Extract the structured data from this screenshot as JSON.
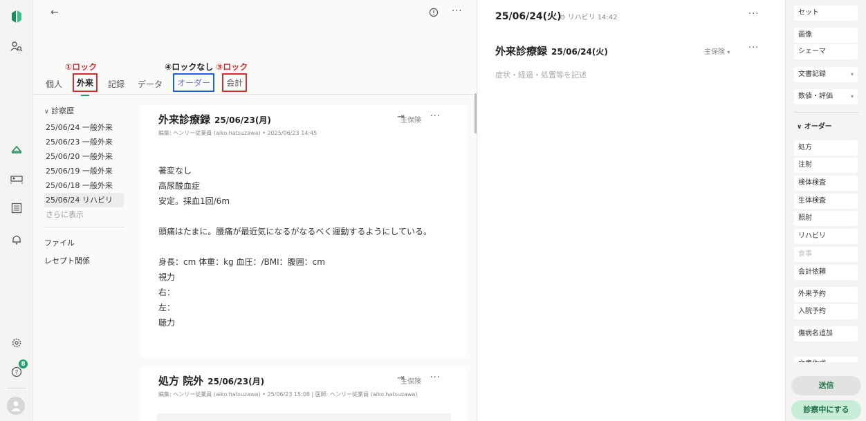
{
  "rail": {
    "notification_count": "8",
    "icons": [
      "logo-icon",
      "patient-search-icon",
      "home-icon",
      "bed-icon",
      "list-icon",
      "bell-icon",
      "settings-icon",
      "help-icon",
      "user-avatar"
    ]
  },
  "annotations": {
    "a1": "①ロック",
    "a4": "④ロックなし",
    "a3": "③ロック"
  },
  "tabs": [
    "個人",
    "外来",
    "記録",
    "データ",
    "オーダー",
    "会計"
  ],
  "sidebar": {
    "history_header": "診察歴",
    "items": [
      "25/06/24 一般外来",
      "25/06/23 一般外来",
      "25/06/20 一般外来",
      "25/06/19 一般外来",
      "25/06/18 一般外来",
      "25/06/24 リハビリ"
    ],
    "more": "さらに表示",
    "file": "ファイル",
    "receipt": "レセプト関係"
  },
  "card1": {
    "title": "外来診療録",
    "date": "25/06/23(月)",
    "meta": "編集: ヘンリー従業員 (aiko.hatsuzawa) • 2025/06/23 14:45",
    "insurance": "主保険",
    "lines": [
      "著変なし",
      "高尿酸血症",
      "安定。採血1回/6m",
      "",
      "頭痛はたまに。腰痛が最近気になるがなるべく運動するようにしている。",
      "",
      "身長：cm 体重：kg 血圧：/BMI：腹囲：cm",
      "視力",
      "右：",
      "左：",
      "聴力"
    ]
  },
  "card2": {
    "title": "処方 院外",
    "date": "25/06/23(月)",
    "meta": "編集: ヘンリー従業員 (aiko.hatsuzawa) • 25/06/23 15:08 | 医師: ヘンリー従業員 (aiko.hatsuzawa)",
    "insurance": "主保険"
  },
  "right": {
    "date": "25/06/24(火)",
    "link": "リハビリ 14:42",
    "title": "外来診療録",
    "title_date": "25/06/24(火)",
    "insurance": "主保険",
    "placeholder": "症状・経過・処置等を記述"
  },
  "orders": {
    "top": [
      "セット",
      "画像",
      "シェーマ",
      "文書記録",
      "数値・評価"
    ],
    "header": "オーダー",
    "items": [
      "処方",
      "注射",
      "検体検査",
      "生体検査",
      "照射",
      "リハビリ",
      "食事",
      "会計依頼",
      "外来予約",
      "入院予約",
      "傷病名追加",
      "文書作成"
    ],
    "send": "送信",
    "start": "診察中にする"
  }
}
